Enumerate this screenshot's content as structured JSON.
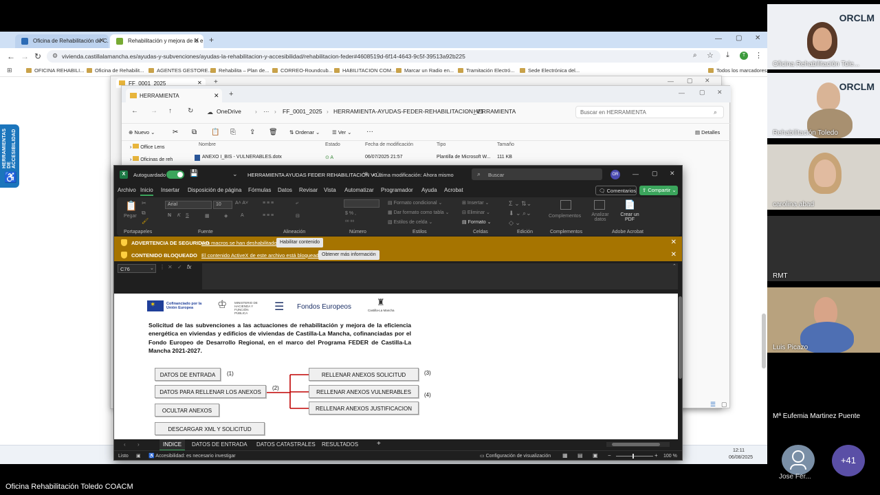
{
  "browser": {
    "tabs": [
      {
        "label": "Oficina de Rehabilitación de C...",
        "close": "✕"
      },
      {
        "label": "Rehabilitación y mejora de la e...",
        "close": "✕"
      }
    ],
    "new_tab": "+",
    "url": "vivienda.castillalamancha.es/ayudas-y-subvenciones/ayudas-la-rehabilitacion-y-accesibilidad/rehabilitacion-feder#4608519d-6f14-4643-9c5f-39513a92b225",
    "profile_initial": "T",
    "bookmarks": [
      "OFICINA REHABILI...",
      "Oficina de Rehabilit...",
      "AGENTES GESTORE...",
      "Rehabilita – Plan de...",
      "CORREO-Roundcub...",
      "HABILITACION COM...",
      "Marcar un Radio en...",
      "Tramitación Electró...",
      "Sede Electrónica del..."
    ],
    "all_bookmarks": "Todos los marcadores",
    "side_widget": "HERRAMIENTAS DE ACCESIBILIDAD",
    "status_time": "12:11",
    "status_date": "06/08/2025"
  },
  "explorer_back": {
    "tab": "FF_0001_2025"
  },
  "explorer": {
    "tab": "HERRAMIENTA",
    "breadcrumb": [
      "OneDrive",
      "···",
      "FF_0001_2025",
      "HERRAMIENTA-AYUDAS-FEDER-REHABILITACION_V1",
      "HERRAMIENTA"
    ],
    "search_placeholder": "Buscar en HERRAMIENTA",
    "commands": {
      "new": "Nuevo",
      "sort": "Ordenar",
      "view": "Ver",
      "more": "···",
      "details": "Detalles"
    },
    "tree": [
      "Office Lens",
      "Oficinas de reh"
    ],
    "columns": [
      "Nombre",
      "Estado",
      "Fecha de modificación",
      "Tipo",
      "Tamaño"
    ],
    "rows": [
      {
        "name": "ANEXO I_BIS - VULNERABLES.dotx",
        "status": "⊙ A",
        "date": "06/07/2025 21:57",
        "type": "Plantilla de Microsoft W...",
        "size": "111 KB"
      }
    ]
  },
  "excel": {
    "autosave": "Autoguardado",
    "title": "HERRAMIENTA AYUDAS FEDER REHABILITACIÓN V0...",
    "last_modified": "• Última modificación: Ahora mismo",
    "search": "Buscar",
    "user_initials": "OR",
    "menu": [
      "Archivo",
      "Inicio",
      "Insertar",
      "Disposición de página",
      "Fórmulas",
      "Datos",
      "Revisar",
      "Vista",
      "Automatizar",
      "Programador",
      "Ayuda",
      "Acrobat"
    ],
    "comments": "Comentarios",
    "share": "Compartir",
    "ribbon": {
      "paste": "Pegar",
      "font": "Arial",
      "font_size": "10",
      "cond_format": "Formato condicional",
      "table_format": "Dar formato como tabla",
      "cell_styles": "Estilos de celda",
      "insert": "Insertar",
      "delete": "Eliminar",
      "format": "Formato",
      "complements": "Complementos",
      "analyze": "Analizar datos",
      "create_pdf": "Crear un PDF",
      "groups": [
        "Portapapeles",
        "Fuente",
        "Alineación",
        "Número",
        "Estilos",
        "Celdas",
        "Edición",
        "Complementos",
        "Adobe Acrobat"
      ]
    },
    "security_bar": {
      "label": "ADVERTENCIA DE SEGURIDAD",
      "message": "Las macros se han deshabilitado.",
      "button": "Habilitar contenido",
      "close": "✕"
    },
    "blocked_bar": {
      "label": "CONTENIDO BLOQUEADO",
      "message": "El contenido ActiveX de este archivo está bloqueado.",
      "button": "Obtener más información",
      "close": "✕"
    },
    "name_box": "C76",
    "fx": "fx",
    "logos": {
      "eu": "Cofinanciado por la Unión Europea",
      "ministry": "MINISTERIO DE HACIENDA Y FUNCIÓN PÚBLICA",
      "funds": "Fondos Europeos",
      "region": "Castilla-La Mancha"
    },
    "heading": "Solicitud de las subvenciones a las actuaciones de rehabilitación y mejora de la eficiencia energética en viviendas y edificios de viviendas de Castilla-La Mancha, cofinanciadas por el Fondo Europeo de Desarrollo Regional, en el marco del Programa FEDER de Castilla-La Mancha 2021-2027.",
    "buttons": {
      "datos_entrada": "DATOS DE ENTRADA",
      "datos_anexos": "DATOS PARA RELLENAR LOS ANEXOS",
      "ocultar": "OCULTAR ANEXOS",
      "descargar": "DESCARGAR XML Y SOLICITUD",
      "solicitud": "RELLENAR ANEXOS SOLICITUD",
      "vulnerables": "RELLENAR ANEXOS VULNERABLES",
      "justificacion": "RELLENAR ANEXOS JUSTIFICACION"
    },
    "notes": [
      "(1)",
      "(2)",
      "(3)",
      "(4)"
    ],
    "sheets": [
      "INDICE",
      "DATOS DE ENTRADA",
      "DATOS CATASTRALES",
      "RESULTADOS"
    ],
    "add_sheet": "+",
    "status": {
      "ready": "Listo",
      "accessibility": "Accesibilidad: es necesario investigar",
      "display": "Configuración de visualización",
      "zoom": "100 %"
    }
  },
  "meeting": {
    "participants": [
      {
        "name": "Oficina Rehabilitación Tole...",
        "brand": "ORCLM"
      },
      {
        "name": "Rehabilitación Toledo",
        "brand": "ORCLM"
      },
      {
        "name": "carolina abad"
      },
      {
        "name": "RMT"
      },
      {
        "name": "Luis Picazo"
      },
      {
        "name": "Mª Eufemia Martinez Puente"
      },
      {
        "name": "Jose Fer..."
      }
    ],
    "more_count": "+41",
    "active_speaker": "Oficina Rehabilitación Toledo COACM"
  }
}
